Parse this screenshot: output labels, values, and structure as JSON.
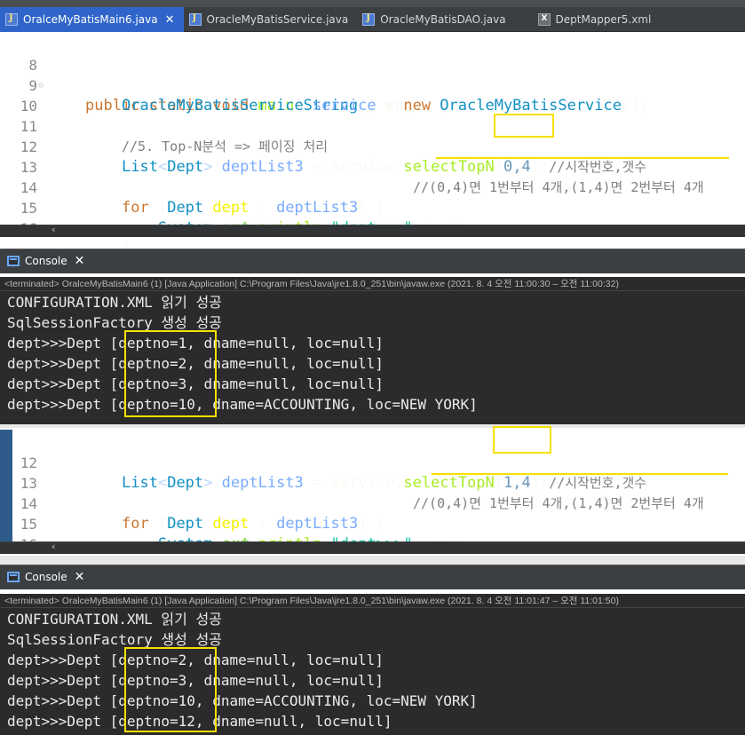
{
  "tabs": [
    {
      "label": "OralceMyBatisMain6.java",
      "icon": "java-file-icon",
      "active": true
    },
    {
      "label": "OracleMyBatisService.java",
      "icon": "java-file-icon",
      "active": false
    },
    {
      "label": "OracleMyBatisDAO.java",
      "icon": "java-file-icon",
      "active": false
    },
    {
      "label": "DeptMapper5.xml",
      "icon": "xml-file-icon",
      "active": false
    }
  ],
  "editor1": {
    "line_numbers": [
      "8",
      "9",
      "10",
      "11",
      "12",
      "13",
      "14",
      "15",
      "16"
    ],
    "line8": {
      "kw1": "public static void ",
      "meth": "main",
      "p1": "(",
      "ty": "String",
      "p2": "[] args) {"
    },
    "line9": {
      "ty1": "OracleMyBatisService",
      "sp": " ",
      "var": "service",
      "p1": " = ",
      "kw": "new",
      "sp2": " ",
      "ty2": "OracleMyBatisService",
      "p2": "();"
    },
    "line11": {
      "cmt": "//5. Top-N분석 => 페이징 처리"
    },
    "line12": {
      "ty": "List",
      "gen1": "<",
      "ty2": "Dept",
      "gen2": ">",
      "sp": " ",
      "var": "deptList3",
      "p1": " = ",
      "var2": "service",
      "p2": ".",
      "meth": "selectTopN",
      "p3": "(",
      "args": "0,4",
      "p4": ");",
      "cmt": "//시작번호,갯수"
    },
    "line13": {
      "cmt": "//(0,4)면 1번부터 4개,(1,4)면 2번부터 4개"
    },
    "line14": {
      "kw": "for",
      "p1": " (",
      "ty": "Dept",
      "sp": " ",
      "var": "dept",
      "p2": " : ",
      "var2": "deptList3",
      "p3": ") {"
    },
    "line15": {
      "ty": "System",
      "p1": ".",
      "fld": "out",
      "p2": ".",
      "meth": "println",
      "p3": "(",
      "str": "\"dept>>>\"",
      "p4": "+dept);"
    },
    "line16": {
      "p": "}"
    }
  },
  "console1": {
    "tab_label": "Console",
    "status": "<terminated> OralceMyBatisMain6 (1) [Java Application] C:\\Program Files\\Java\\jre1.8.0_251\\bin\\javaw.exe  (2021. 8. 4 오전 11:00:30 – 오전 11:00:32)",
    "lines": [
      "CONFIGURATION.XML 읽기 성공",
      "SqlSessionFactory 생성 성공",
      "dept>>>Dept [deptno=1, dname=null, loc=null]",
      "dept>>>Dept [deptno=2, dname=null, loc=null]",
      "dept>>>Dept [deptno=3, dname=null, loc=null]",
      "dept>>>Dept [deptno=10, dname=ACCOUNTING, loc=NEW YORK]"
    ]
  },
  "editor2": {
    "line_numbers": [
      "12",
      "13",
      "14",
      "15",
      "16"
    ],
    "line12": {
      "ty": "List",
      "gen1": "<",
      "ty2": "Dept",
      "gen2": ">",
      "sp": " ",
      "var": "deptList3",
      "p1": " = ",
      "var2": "service",
      "p2": ".",
      "meth": "selectTopN",
      "p3": "(",
      "args": "1,4",
      "p4": ");",
      "cmt": "//시작번호,갯수"
    },
    "line13": {
      "cmt": "//(0,4)면 1번부터 4개,(1,4)면 2번부터 4개"
    },
    "line14": {
      "kw": "for",
      "p1": " (",
      "ty": "Dept",
      "sp": " ",
      "var": "dept",
      "p2": " : ",
      "var2": "deptList3",
      "p3": ") {"
    },
    "line15": {
      "ty": "System",
      "p1": ".",
      "fld": "out",
      "p2": ".",
      "meth": "println",
      "p3": "(",
      "str": "\"dept>>>\"",
      "p4": "+dept);"
    },
    "line16": {
      "p": "}"
    }
  },
  "console2": {
    "tab_label": "Console",
    "status": "<terminated> OralceMyBatisMain6 (1) [Java Application] C:\\Program Files\\Java\\jre1.8.0_251\\bin\\javaw.exe  (2021. 8. 4 오전 11:01:47 – 오전 11:01:50)",
    "lines": [
      "CONFIGURATION.XML 읽기 성공",
      "SqlSessionFactory 생성 성공",
      "dept>>>Dept [deptno=2, dname=null, loc=null]",
      "dept>>>Dept [deptno=3, dname=null, loc=null]",
      "dept>>>Dept [deptno=10, dname=ACCOUNTING, loc=NEW YORK]",
      "dept>>>Dept [deptno=12, dname=null, loc=null]"
    ]
  },
  "colors": {
    "highlight": "#f6e000",
    "editor_bg": "#2b2b2b",
    "active_tab": "#2f65ca"
  }
}
